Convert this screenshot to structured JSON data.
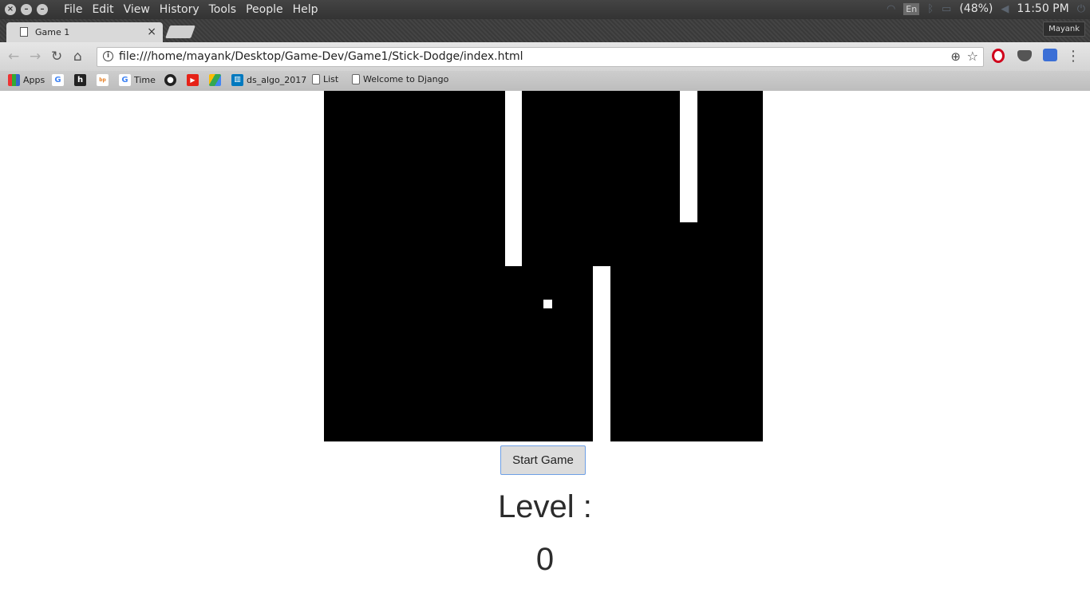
{
  "os_bar": {
    "menus": [
      "File",
      "Edit",
      "View",
      "History",
      "Tools",
      "People",
      "Help"
    ],
    "keyboard_layout": "En",
    "battery": "(48%)",
    "clock": "11:50 PM"
  },
  "browser": {
    "tab_title": "Game 1",
    "profile_name": "Mayank",
    "url": "file:///home/mayank/Desktop/Game-Dev/Game1/Stick-Dodge/index.html",
    "bookmarks": [
      {
        "label": "Apps",
        "icon": "apps-grid-icon"
      },
      {
        "label": "",
        "icon": "google-icon"
      },
      {
        "label": "",
        "icon": "hackerrank-icon"
      },
      {
        "label": "",
        "icon": "backpack-icon"
      },
      {
        "label": "Time",
        "icon": "google-icon"
      },
      {
        "label": "",
        "icon": "github-icon"
      },
      {
        "label": "",
        "icon": "youtube-icon"
      },
      {
        "label": "",
        "icon": "drive-icon"
      },
      {
        "label": "ds_algo_2017",
        "icon": "trello-icon"
      },
      {
        "label": "List",
        "icon": "page-icon"
      },
      {
        "label": "Welcome to Django",
        "icon": "page-icon"
      }
    ]
  },
  "game": {
    "start_button": "Start Game",
    "level_label": "Level :",
    "level_value": "0"
  }
}
